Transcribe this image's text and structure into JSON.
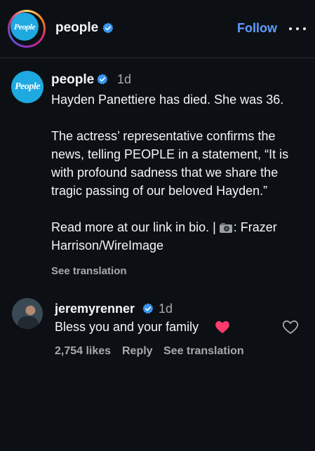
{
  "header": {
    "avatar_logo_text": "People",
    "username": "people",
    "follow_label": "Follow"
  },
  "post": {
    "avatar_logo_text": "People",
    "username": "people",
    "time": "1d",
    "caption_lines": [
      "Hayden Panettiere has died. She was 36.",
      "The actress’ representative confirms the news, telling PEOPLE in a statement, “It is with profound sadness that we share the tragic passing of our beloved Hayden.”"
    ],
    "caption_last_prefix": "Read more at our link in bio. | ",
    "caption_last_suffix": ": Frazer Harrison/WireImage",
    "see_translation": "See translation"
  },
  "comment": {
    "username": "jeremyrenner",
    "time": "1d",
    "text": "Bless you and your family",
    "likes": "2,754 likes",
    "reply": "Reply",
    "see_translation": "See translation"
  },
  "colors": {
    "background": "#0c1014",
    "accent_link": "#5f9cff",
    "verified": "#3897f0",
    "people_logo": "#1fa9e1",
    "heart": "#ff3b6b",
    "muted": "#a8a8a8"
  },
  "icons": [
    "verified-badge-icon",
    "more-options-icon",
    "camera-emoji-icon",
    "heart-emoji-icon",
    "like-heart-icon"
  ]
}
